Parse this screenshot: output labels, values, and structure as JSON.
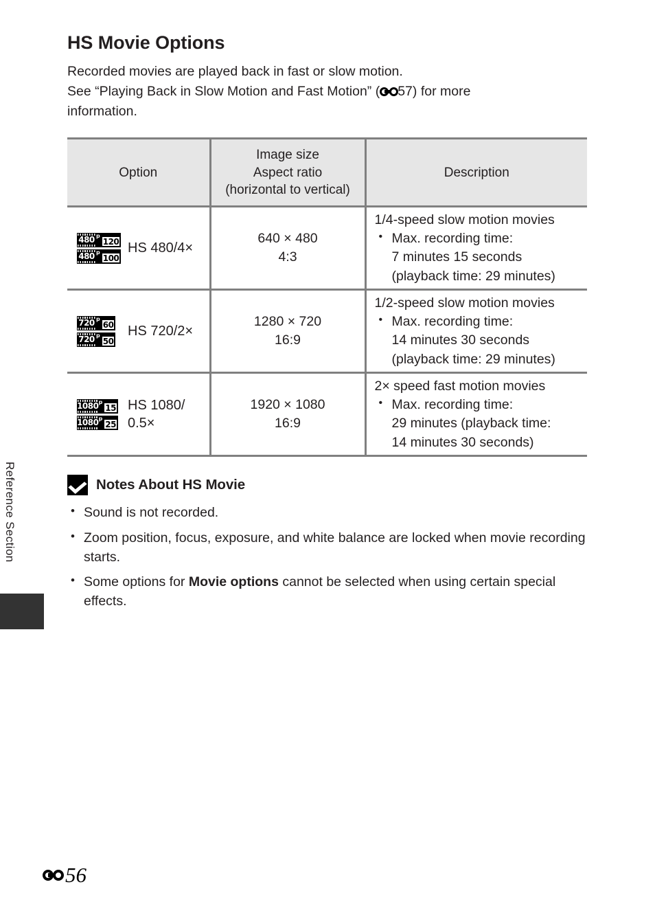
{
  "margin": {
    "section_label": "Reference Section"
  },
  "header": {
    "title": "HS Movie Options",
    "intro_line1": "Recorded movies are played back in fast or slow motion.",
    "intro_line2_part1": "See “Playing Back in Slow Motion and Fast Motion” (",
    "intro_line2_ref": "57",
    "intro_line2_part2": ") for more",
    "intro_line3": "information."
  },
  "table": {
    "columns": [
      {
        "key": "option",
        "label": "Option"
      },
      {
        "key": "size",
        "label_line1": "Image size",
        "label_line2": "Aspect ratio",
        "label_line3": "(horizontal to vertical)"
      },
      {
        "key": "description",
        "label": "Description"
      }
    ],
    "rows": [
      {
        "option_label": "HS 480/4×",
        "icons": [
          {
            "resolution": "480",
            "progressive": "p",
            "rate": "120"
          },
          {
            "resolution": "480",
            "progressive": "p",
            "rate": "100"
          }
        ],
        "image_size": "640 × 480",
        "aspect_ratio": "4:3",
        "desc_lead": "1/4-speed slow motion movies",
        "desc_bullet": "Max. recording time:",
        "desc_sub1": "7 minutes 15 seconds",
        "desc_sub2": "(playback time: 29 minutes)"
      },
      {
        "option_label": "HS 720/2×",
        "icons": [
          {
            "resolution": "720",
            "progressive": "p",
            "rate": "60"
          },
          {
            "resolution": "720",
            "progressive": "p",
            "rate": "50"
          }
        ],
        "image_size": "1280 × 720",
        "aspect_ratio": "16:9",
        "desc_lead": "1/2-speed slow motion movies",
        "desc_bullet": "Max. recording time:",
        "desc_sub1": "14 minutes 30 seconds",
        "desc_sub2": "(playback time: 29 minutes)"
      },
      {
        "option_label": "HS 1080/\n0.5×",
        "icons": [
          {
            "resolution": "1080",
            "progressive": "p",
            "rate": "15"
          },
          {
            "resolution": "1080",
            "progressive": "p",
            "rate": "25"
          }
        ],
        "image_size": "1920 × 1080",
        "aspect_ratio": "16:9",
        "desc_lead": "2× speed fast motion movies",
        "desc_bullet": "Max. recording time:",
        "desc_sub1": "29 minutes (playback time:",
        "desc_sub2": "14 minutes 30 seconds)"
      }
    ]
  },
  "notes": {
    "title": "Notes About HS Movie",
    "items": [
      {
        "text": "Sound is not recorded."
      },
      {
        "text": "Zoom position, focus, exposure, and white balance are locked when movie recording starts."
      },
      {
        "prefix": "Some options for ",
        "bold": "Movie options",
        "suffix": " cannot be selected when using certain special effects."
      }
    ]
  },
  "footer": {
    "page_number": "56"
  },
  "colors": {
    "text": "#231f20",
    "rule": "#808080",
    "header_fill": "#e6e6e6",
    "tab_block": "#333333"
  }
}
